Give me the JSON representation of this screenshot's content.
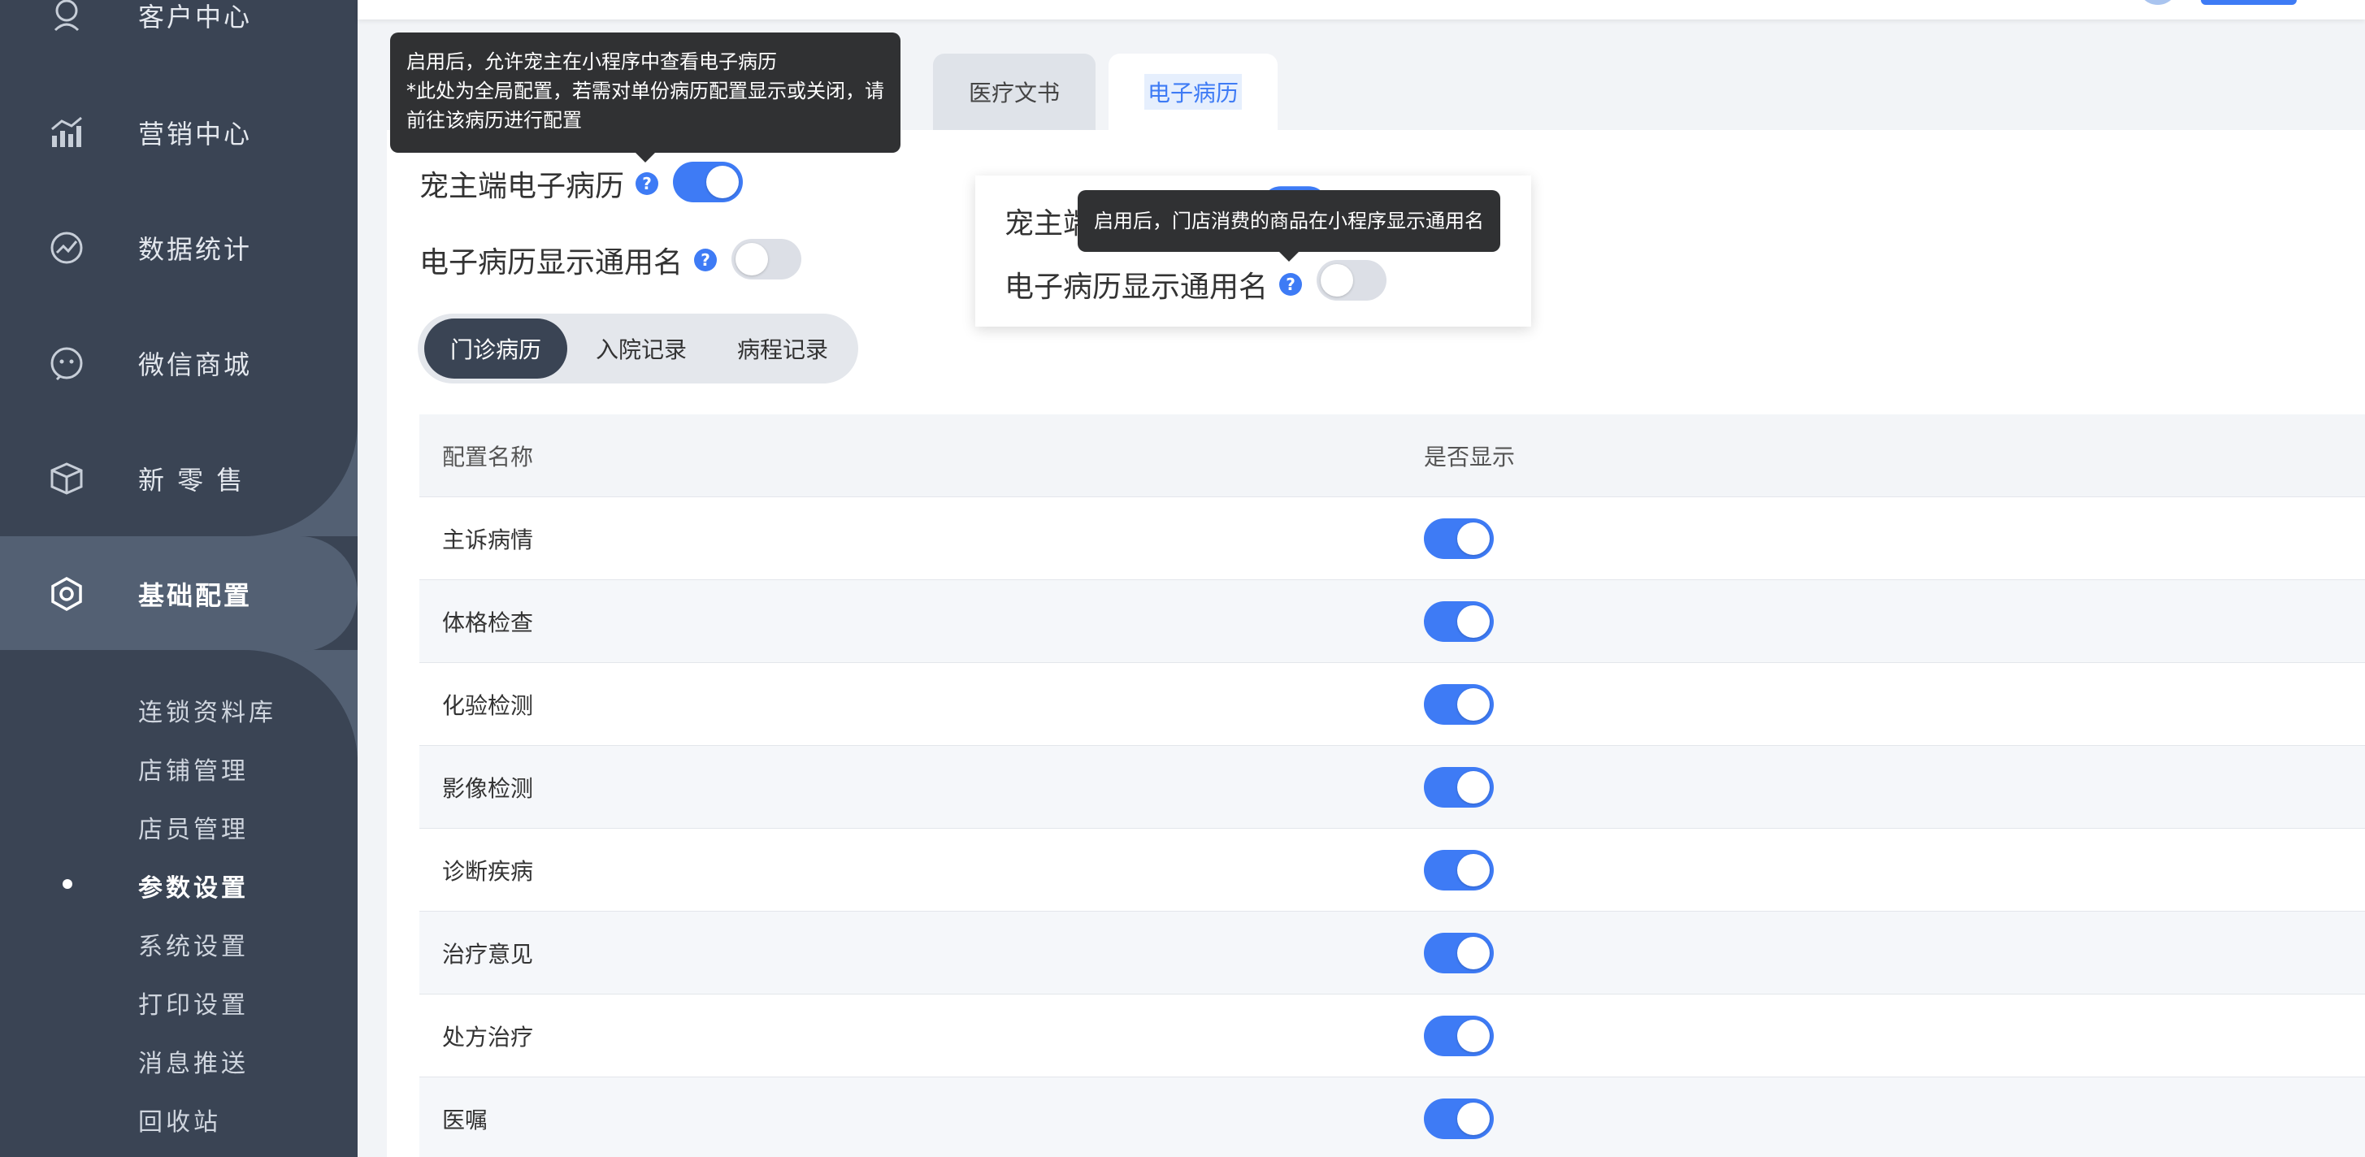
{
  "sidebar": {
    "items": [
      {
        "label": "客户中心",
        "icon": "customer-icon"
      },
      {
        "label": "营销中心",
        "icon": "marketing-icon"
      },
      {
        "label": "数据统计",
        "icon": "stats-icon"
      },
      {
        "label": "微信商城",
        "icon": "wechat-mall-icon"
      },
      {
        "label": "新 零 售",
        "icon": "retail-box-icon"
      },
      {
        "label": "基础配置",
        "icon": "settings-icon"
      }
    ],
    "sub_items": [
      "连锁资料库",
      "店铺管理",
      "店员管理",
      "参数设置",
      "系统设置",
      "打印设置",
      "消息推送",
      "回收站"
    ],
    "active_sub": "参数设置"
  },
  "tabs": [
    {
      "label": "医疗文书"
    },
    {
      "label": "电子病历"
    }
  ],
  "settings": {
    "owner_record_label": "宠主端电子病历",
    "owner_record_on": true,
    "generic_name_label": "电子病历显示通用名",
    "generic_name_on": false
  },
  "segments": [
    "门诊病历",
    "入院记录",
    "病程记录"
  ],
  "table": {
    "headers": [
      "配置名称",
      "是否显示"
    ],
    "rows": [
      {
        "name": "主诉病情",
        "on": true
      },
      {
        "name": "体格检查",
        "on": true
      },
      {
        "name": "化验检测",
        "on": true
      },
      {
        "name": "影像检测",
        "on": true
      },
      {
        "name": "诊断疾病",
        "on": true
      },
      {
        "name": "治疗意见",
        "on": true
      },
      {
        "name": "处方治疗",
        "on": true
      },
      {
        "name": "医嘱",
        "on": true
      }
    ]
  },
  "tooltips": {
    "owner_record": [
      "启用后，允许宠主在小程序中查看电子病历",
      "*此处为全局配置，若需对单份病历配置显示或关闭，请",
      "前往该病历进行配置"
    ],
    "generic_name": "启用后，门店消费的商品在小程序显示通用名"
  },
  "popup": {
    "row1_label": "宠主端电子病历",
    "row2_label": "电子病历显示通用名"
  },
  "colors": {
    "accent": "#3e7bf5",
    "sidebar_bg": "#3a4454",
    "sidebar_active": "#536073"
  }
}
